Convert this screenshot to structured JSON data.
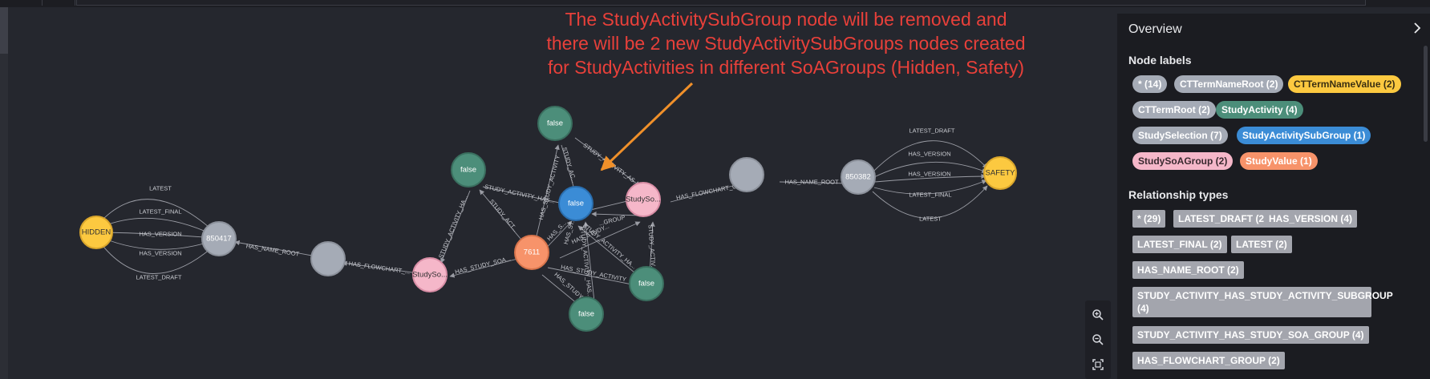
{
  "annotation": {
    "line1": "The StudyActivitySubGroup node will be removed and",
    "line2": "there will be 2 new StudyActivitySubGroups nodes created",
    "line3": "for StudyActivities in different SoAGroups (Hidden, Safety)",
    "color": "#e8403a",
    "arrow_color": "#f0902a"
  },
  "graph": {
    "nodes": {
      "hidden": "HIDDEN",
      "left_root": "850417",
      "left_gray": "",
      "left_soagroup": "StudySo...",
      "studyvalue": "7611",
      "subgroup": "false",
      "act_top": "false",
      "act_left": "false",
      "act_right": "false",
      "act_bottom": "false",
      "right_soagroup": "StudySo...",
      "right_gray": "",
      "right_root": "850382",
      "safety": "SAFETY"
    },
    "rels": {
      "l_latest": "LATEST",
      "l_latest_final": "LATEST_FINAL",
      "l_has_version_1": "HAS_VERSION",
      "l_has_version_2": "HAS_VERSION",
      "l_latest_draft": "LATEST_DRAFT",
      "l_has_name_root": "HAS_NAME_ROOT",
      "l_has_flowchart": "HAS_FLOWCHART_...",
      "has_study_soa": "HAS_STUDY_SOA...",
      "study_activity_ha_1": "STUDY_ACTIVITY_HA...",
      "study_activity_has": "STUDY_ACTIVITY_HAS...",
      "study_act": "STUDY_ACT...",
      "has_study_act": "HAS_STUDY_ACTIVITY",
      "study_ac": "STUDY_AC...",
      "study_activity_as": "STUDY_ACTIVITY_AS...",
      "group": "...GROUP",
      "has_s": "HAS_S...",
      "has_study_2": "HAS_STUDY_...",
      "has_study_activity_2": "HAS_STUDY_ACTIVITY",
      "study_activity_ha_2": "STUDY_ACTIVITY_HA...",
      "has_study_3": "HAS_STUDY...",
      "study_activity_has_2": "STUDY_ACTIVITY_HAS...",
      "has_st": "HAS_ST...",
      "study_activ": "STUDY_ACTIV...",
      "r_has_flowchart": "HAS_FLOWCHART_G...",
      "r_has_name_root": "HAS_NAME_ROOT",
      "r_latest_draft": "LATEST_DRAFT",
      "r_has_version_1": "HAS_VERSION",
      "r_has_version_2": "HAS_VERSION",
      "r_latest_final": "LATEST_FINAL",
      "r_latest": "LATEST"
    },
    "colors": {
      "yellow": "#fcc940",
      "gray": "#a5abb6",
      "green": "#4c8e7a",
      "blue": "#3b8cd6",
      "pink": "#f5b7c9",
      "orange": "#f7936a"
    }
  },
  "panel": {
    "title": "Overview",
    "node_labels_heading": "Node labels",
    "node_labels": [
      {
        "label": "* (14)",
        "bg": "#a5abb6",
        "fg": "#ffffff"
      },
      {
        "label": "CTTermNameRoot (2)",
        "bg": "#a5abb6",
        "fg": "#ffffff"
      },
      {
        "label": "CTTermNameValue (2)",
        "bg": "#fcc940",
        "fg": "#3a2f12"
      },
      {
        "label": "CTTermRoot (2)",
        "bg": "#a5abb6",
        "fg": "#ffffff"
      },
      {
        "label": "StudyActivity (4)",
        "bg": "#4c8e7a",
        "fg": "#ffffff"
      },
      {
        "label": "StudySelection (7)",
        "bg": "#a5abb6",
        "fg": "#ffffff"
      },
      {
        "label": "StudyActivitySubGroup (1)",
        "bg": "#3b8cd6",
        "fg": "#ffffff"
      },
      {
        "label": "StudySoAGroup (2)",
        "bg": "#f5b7c9",
        "fg": "#3a2a30"
      },
      {
        "label": "StudyValue (1)",
        "bg": "#f7936a",
        "fg": "#ffffff"
      }
    ],
    "rel_types_heading": "Relationship types",
    "rel_types": [
      "* (29)",
      "LATEST_DRAFT (2)",
      "HAS_VERSION (4)",
      "LATEST_FINAL (2)",
      "LATEST (2)",
      "HAS_NAME_ROOT (2)",
      "STUDY_ACTIVITY_HAS_STUDY_ACTIVITY_SUBGROUP (4)",
      "STUDY_ACTIVITY_HAS_STUDY_SOA_GROUP (4)",
      "HAS_FLOWCHART_GROUP (2)"
    ]
  },
  "zoom": {
    "in_icon": "zoom-in-icon",
    "out_icon": "zoom-out-icon",
    "fit_icon": "fit-to-screen-icon"
  }
}
